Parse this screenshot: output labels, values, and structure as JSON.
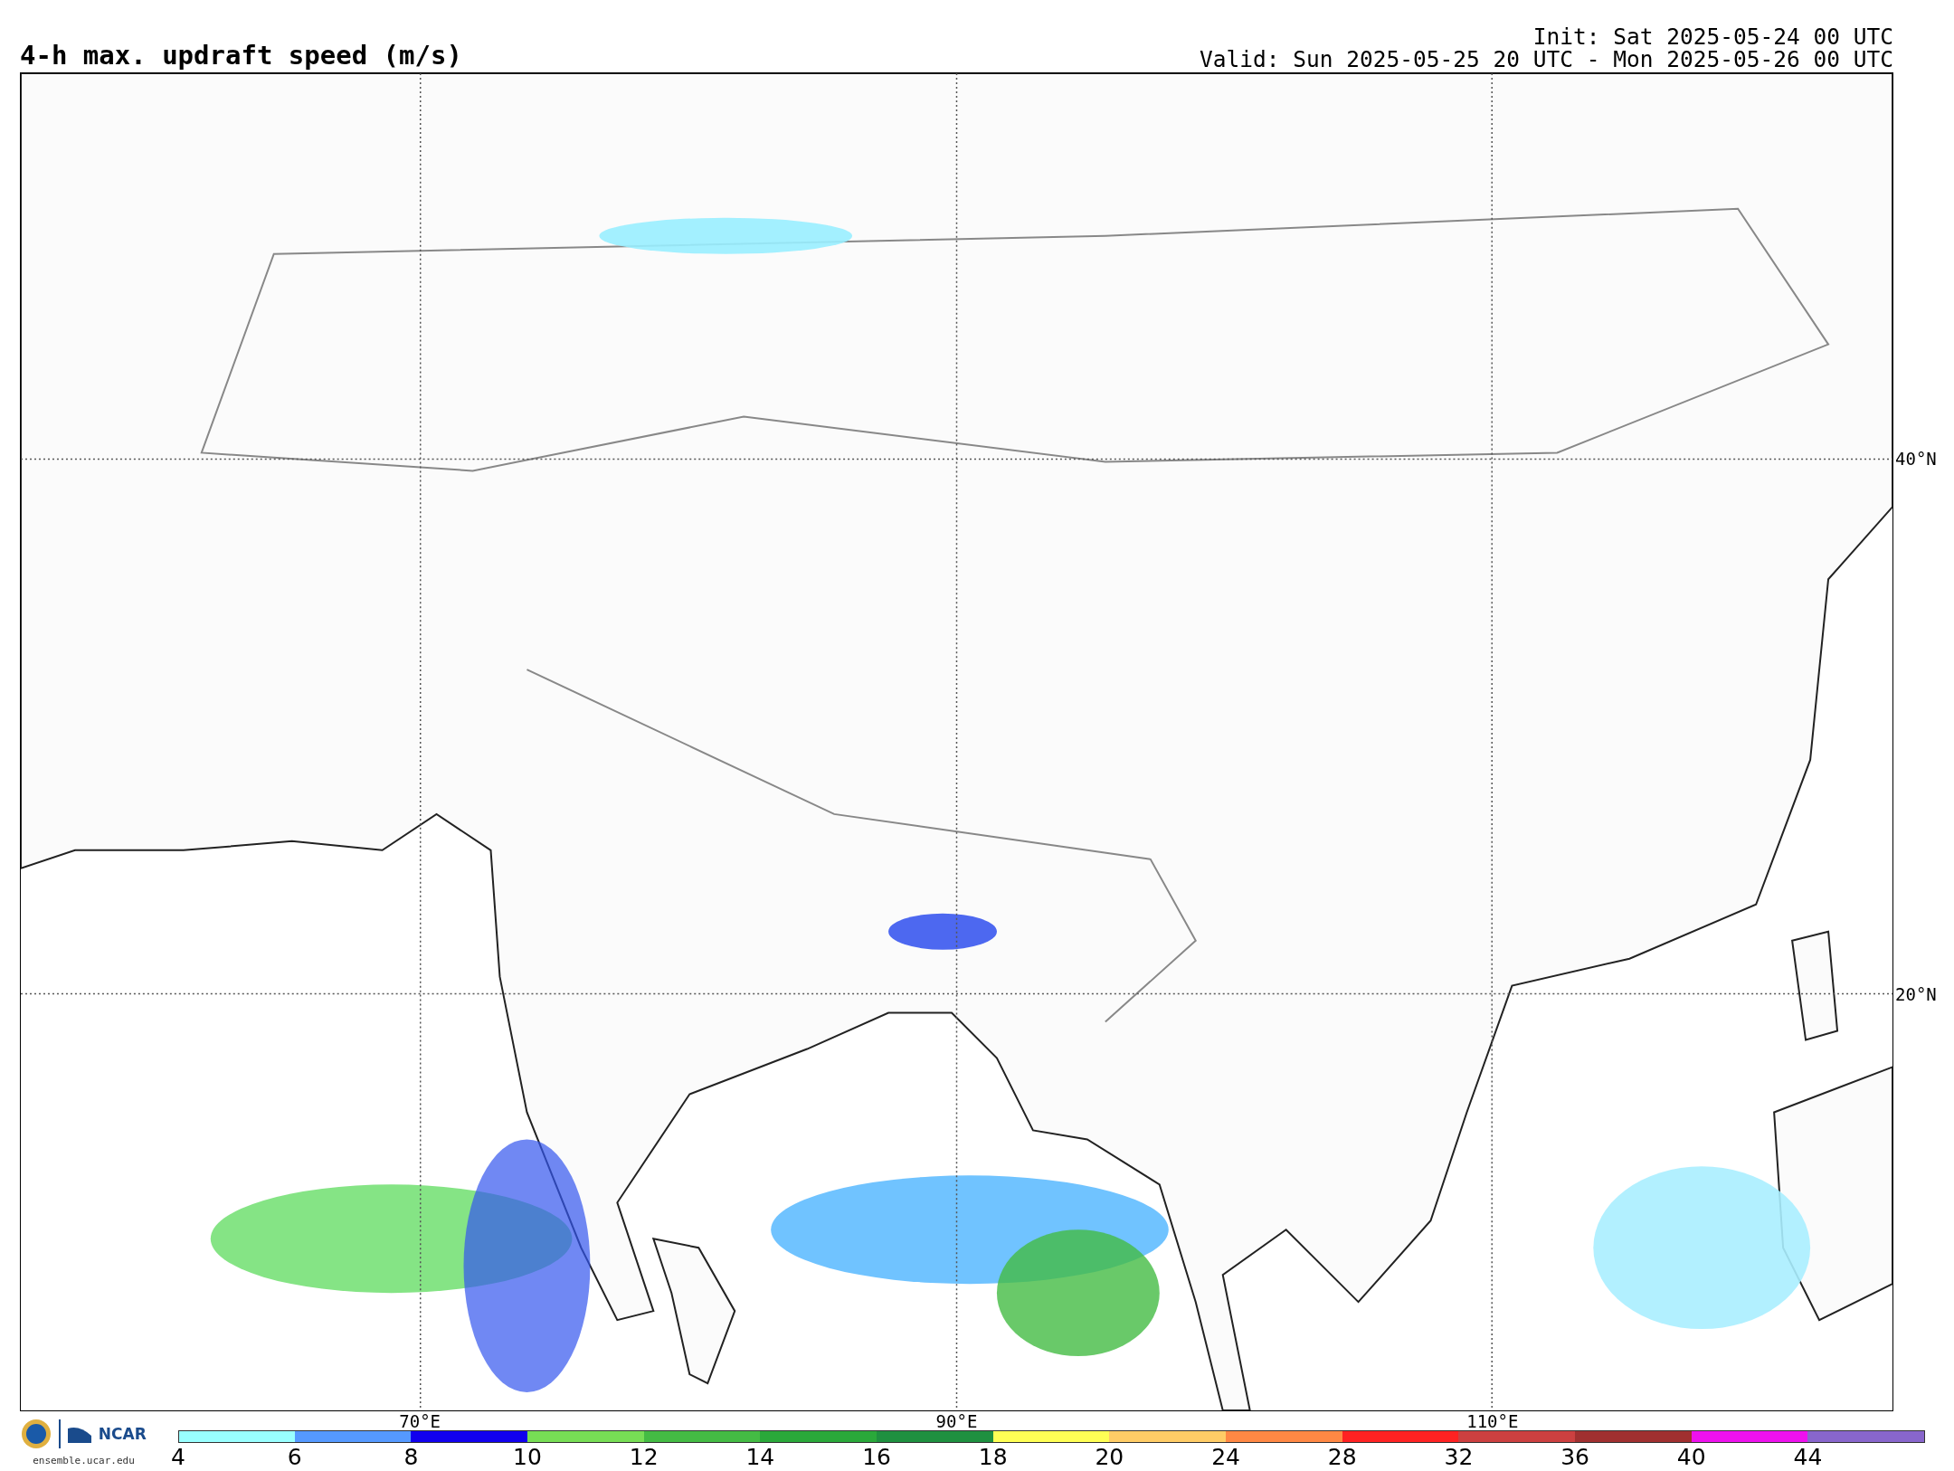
{
  "title": "4-h max. updraft speed (m/s)",
  "init": "Init: Sat 2025-05-24 00 UTC",
  "valid": "Valid: Sun 2025-05-25 20 UTC - Mon 2025-05-26 00 UTC",
  "map": {
    "lon_labels": [
      "70°E",
      "90°E",
      "110°E"
    ],
    "lat_labels": [
      "40°N",
      "20°N"
    ]
  },
  "logo": {
    "org": "NCAR",
    "site": "ensemble.ucar.edu"
  },
  "colorbar": [
    {
      "label": "4",
      "color": "#99ffff"
    },
    {
      "label": "6",
      "color": "#5599ff"
    },
    {
      "label": "8",
      "color": "#1100ee"
    },
    {
      "label": "10",
      "color": "#77dd55"
    },
    {
      "label": "12",
      "color": "#44bb44"
    },
    {
      "label": "14",
      "color": "#2aa83a"
    },
    {
      "label": "16",
      "color": "#1f9040"
    },
    {
      "label": "18",
      "color": "#ffff55"
    },
    {
      "label": "20",
      "color": "#ffcc66"
    },
    {
      "label": "24",
      "color": "#ff8844"
    },
    {
      "label": "28",
      "color": "#ff2222"
    },
    {
      "label": "32",
      "color": "#cc4040"
    },
    {
      "label": "36",
      "color": "#a03030"
    },
    {
      "label": "40",
      "color": "#ee11ee"
    },
    {
      "label": "44",
      "color": "#8866cc"
    }
  ]
}
